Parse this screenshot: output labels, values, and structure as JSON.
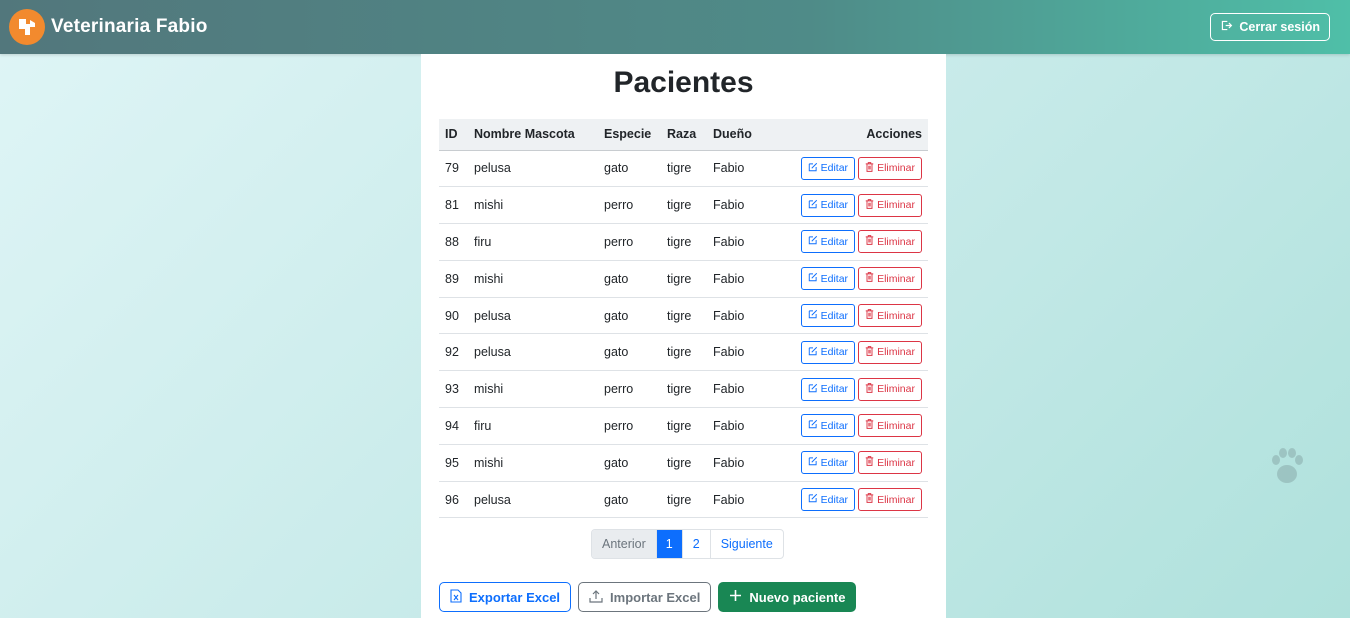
{
  "header": {
    "brand": "Veterinaria Fabio",
    "logout_label": "Cerrar sesión"
  },
  "main": {
    "title": "Pacientes",
    "columns": [
      "ID",
      "Nombre Mascota",
      "Especie",
      "Raza",
      "Dueño",
      "Acciones"
    ],
    "rows": [
      {
        "id": "79",
        "name": "pelusa",
        "species": "gato",
        "breed": "tigre",
        "owner": "Fabio"
      },
      {
        "id": "81",
        "name": "mishi",
        "species": "perro",
        "breed": "tigre",
        "owner": "Fabio"
      },
      {
        "id": "88",
        "name": "firu",
        "species": "perro",
        "breed": "tigre",
        "owner": "Fabio"
      },
      {
        "id": "89",
        "name": "mishi",
        "species": "gato",
        "breed": "tigre",
        "owner": "Fabio"
      },
      {
        "id": "90",
        "name": "pelusa",
        "species": "gato",
        "breed": "tigre",
        "owner": "Fabio"
      },
      {
        "id": "92",
        "name": "pelusa",
        "species": "gato",
        "breed": "tigre",
        "owner": "Fabio"
      },
      {
        "id": "93",
        "name": "mishi",
        "species": "perro",
        "breed": "tigre",
        "owner": "Fabio"
      },
      {
        "id": "94",
        "name": "firu",
        "species": "perro",
        "breed": "tigre",
        "owner": "Fabio"
      },
      {
        "id": "95",
        "name": "mishi",
        "species": "gato",
        "breed": "tigre",
        "owner": "Fabio"
      },
      {
        "id": "96",
        "name": "pelusa",
        "species": "gato",
        "breed": "tigre",
        "owner": "Fabio"
      }
    ],
    "row_actions": {
      "edit": "Editar",
      "delete": "Eliminar"
    }
  },
  "pagination": {
    "prev": "Anterior",
    "pages": [
      "1",
      "2"
    ],
    "current": "1",
    "next": "Siguiente"
  },
  "actions": {
    "export": "Exportar Excel",
    "import": "Importar Excel",
    "new": "Nuevo paciente"
  },
  "icons": {
    "logo": "veterinary-logo-icon",
    "logout": "box-arrow-right-icon",
    "edit": "pencil-square-icon",
    "delete": "trash-icon",
    "export": "file-excel-icon",
    "import": "upload-icon",
    "new": "plus-icon",
    "decor": "paw-icon"
  },
  "colors": {
    "primary": "#0d6efd",
    "danger": "#dc3545",
    "success": "#198754",
    "secondary": "#6c757d",
    "brand_orange": "#f28a2e"
  }
}
